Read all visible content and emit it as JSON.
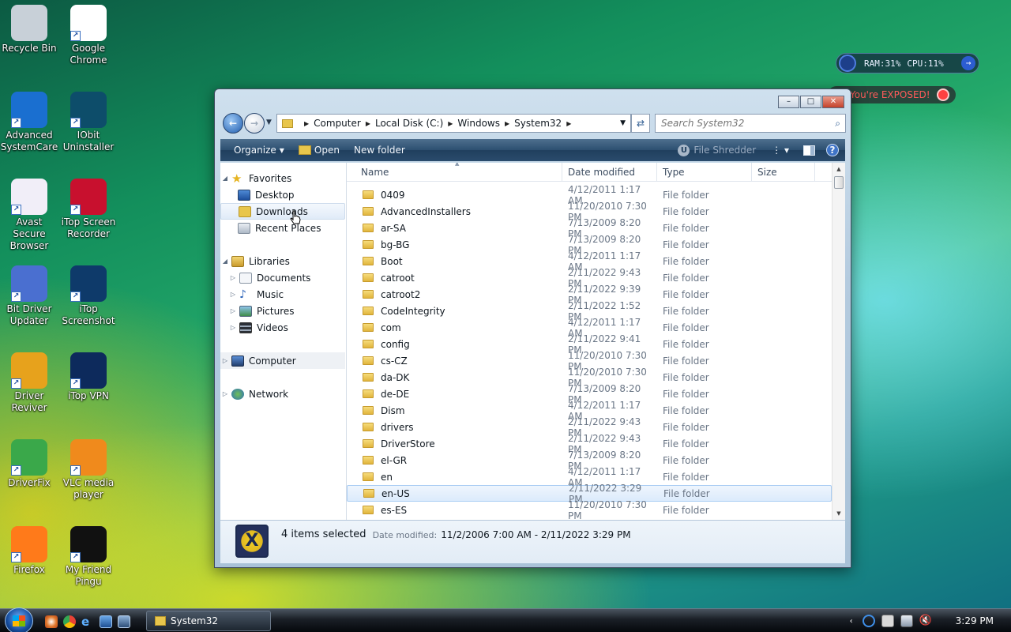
{
  "desktop": {
    "icons": [
      {
        "label": "Recycle Bin",
        "icon": "recycle-bin-icon"
      },
      {
        "label": "Google Chrome",
        "icon": "chrome-icon"
      },
      {
        "label": "Advanced SystemCare",
        "icon": "systemcare-icon"
      },
      {
        "label": "IObit Uninstaller",
        "icon": "iobit-uninstaller-icon"
      },
      {
        "label": "Avast Secure Browser",
        "icon": "avast-browser-icon"
      },
      {
        "label": "iTop Screen Recorder",
        "icon": "itop-recorder-icon"
      },
      {
        "label": "Bit Driver Updater",
        "icon": "bit-driver-icon"
      },
      {
        "label": "iTop Screenshot",
        "icon": "itop-screenshot-icon"
      },
      {
        "label": "Driver Reviver",
        "icon": "driver-reviver-icon"
      },
      {
        "label": "iTop VPN",
        "icon": "itop-vpn-icon"
      },
      {
        "label": "DriverFix",
        "icon": "driverfix-icon"
      },
      {
        "label": "VLC media player",
        "icon": "vlc-icon"
      },
      {
        "label": "Firefox",
        "icon": "firefox-icon"
      },
      {
        "label": "My Friend Pingu",
        "icon": "pingu-icon"
      }
    ]
  },
  "widgets": {
    "ram": "RAM:31%",
    "cpu": "CPU:11%",
    "exposed": "You're EXPOSED!"
  },
  "window": {
    "caption": {
      "minimize": "–",
      "maximize": "□",
      "close": "✕"
    },
    "address": {
      "crumbs": [
        "Computer",
        "Local Disk (C:)",
        "Windows",
        "System32"
      ]
    },
    "search": {
      "placeholder": "Search System32"
    },
    "toolbar": {
      "organize": "Organize",
      "open": "Open",
      "new_folder": "New folder",
      "file_shredder": "File Shredder"
    },
    "nav": {
      "favorites": "Favorites",
      "desktop": "Desktop",
      "downloads": "Downloads",
      "recent_places": "Recent Places",
      "libraries": "Libraries",
      "documents": "Documents",
      "music": "Music",
      "pictures": "Pictures",
      "videos": "Videos",
      "computer": "Computer",
      "network": "Network"
    },
    "columns": {
      "name": "Name",
      "date_modified": "Date modified",
      "type": "Type",
      "size": "Size"
    },
    "rows": [
      {
        "name": "0409",
        "date": "4/12/2011 1:17 AM",
        "type": "File folder"
      },
      {
        "name": "AdvancedInstallers",
        "date": "11/20/2010 7:30 PM",
        "type": "File folder"
      },
      {
        "name": "ar-SA",
        "date": "7/13/2009 8:20 PM",
        "type": "File folder"
      },
      {
        "name": "bg-BG",
        "date": "7/13/2009 8:20 PM",
        "type": "File folder"
      },
      {
        "name": "Boot",
        "date": "4/12/2011 1:17 AM",
        "type": "File folder"
      },
      {
        "name": "catroot",
        "date": "2/11/2022 9:43 PM",
        "type": "File folder"
      },
      {
        "name": "catroot2",
        "date": "2/11/2022 9:39 PM",
        "type": "File folder"
      },
      {
        "name": "CodeIntegrity",
        "date": "2/11/2022 1:52 PM",
        "type": "File folder"
      },
      {
        "name": "com",
        "date": "4/12/2011 1:17 AM",
        "type": "File folder"
      },
      {
        "name": "config",
        "date": "2/11/2022 9:41 PM",
        "type": "File folder"
      },
      {
        "name": "cs-CZ",
        "date": "11/20/2010 7:30 PM",
        "type": "File folder"
      },
      {
        "name": "da-DK",
        "date": "11/20/2010 7:30 PM",
        "type": "File folder"
      },
      {
        "name": "de-DE",
        "date": "7/13/2009 8:20 PM",
        "type": "File folder"
      },
      {
        "name": "Dism",
        "date": "4/12/2011 1:17 AM",
        "type": "File folder"
      },
      {
        "name": "drivers",
        "date": "2/11/2022 9:43 PM",
        "type": "File folder"
      },
      {
        "name": "DriverStore",
        "date": "2/11/2022 9:43 PM",
        "type": "File folder"
      },
      {
        "name": "el-GR",
        "date": "7/13/2009 8:20 PM",
        "type": "File folder"
      },
      {
        "name": "en",
        "date": "4/12/2011 1:17 AM",
        "type": "File folder"
      },
      {
        "name": "en-US",
        "date": "2/11/2022 3:29 PM",
        "type": "File folder",
        "selected": true
      },
      {
        "name": "es-ES",
        "date": "11/20/2010 7:30 PM",
        "type": "File folder"
      }
    ],
    "details": {
      "selection": "4 items selected",
      "date_label": "Date modified:",
      "date_range": "11/2/2006 7:00 AM - 2/11/2022 3:29 PM"
    }
  },
  "taskbar": {
    "task": "System32",
    "clock": "3:29 PM"
  },
  "colors": {
    "accent": "#2c4f70",
    "selection": "#dcebfc",
    "exposed_red": "#ff5a5a"
  }
}
